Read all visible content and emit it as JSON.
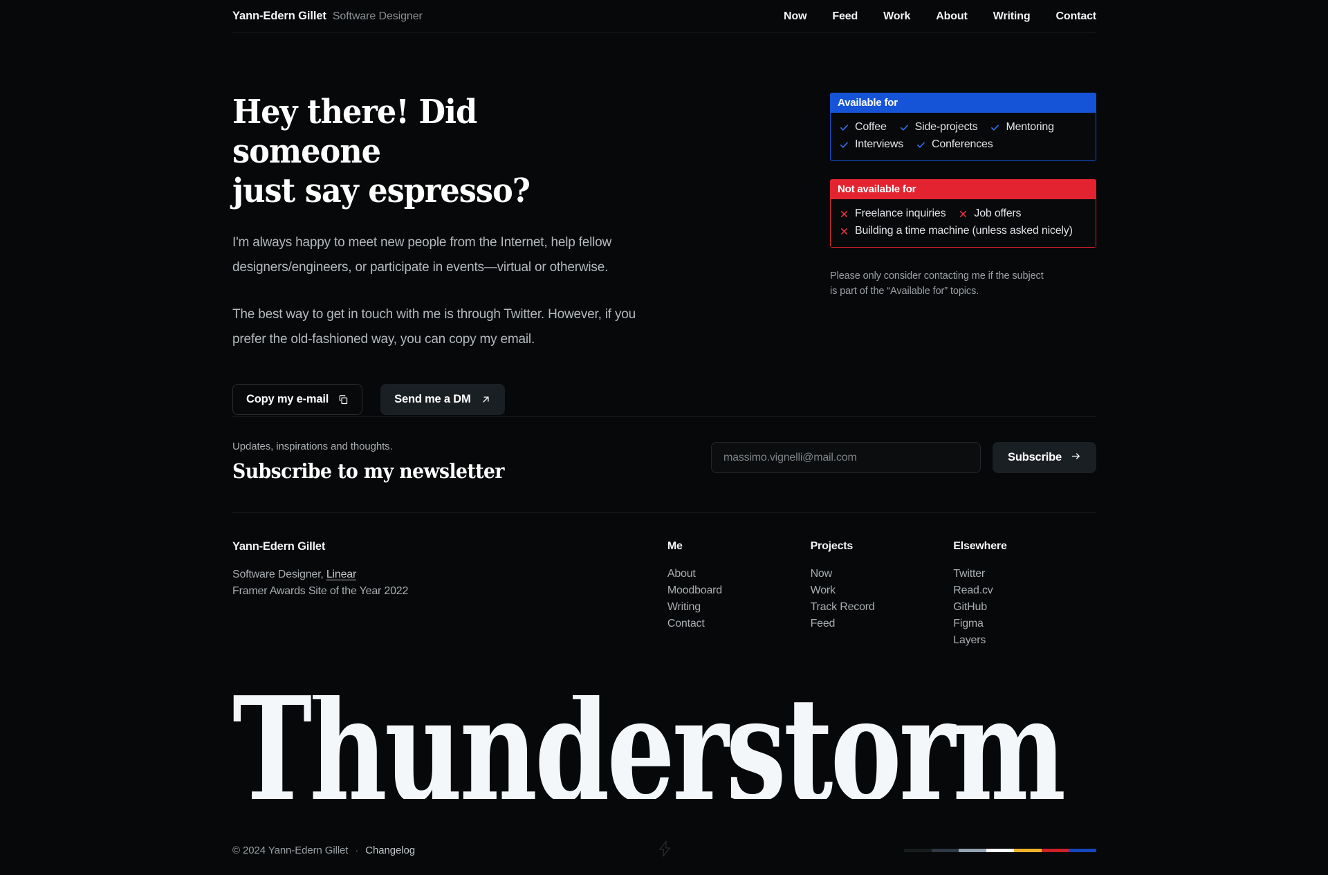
{
  "header": {
    "brand_name": "Yann-Edern Gillet",
    "brand_role": "Software Designer",
    "nav": [
      {
        "label": "Now"
      },
      {
        "label": "Feed"
      },
      {
        "label": "Work"
      },
      {
        "label": "About"
      },
      {
        "label": "Writing"
      },
      {
        "label": "Contact"
      }
    ]
  },
  "hero": {
    "title": "Hey there! Did someone\njust say espresso?",
    "paragraph_1": "I'm always happy to meet new people from the Internet, help fellow designers/engineers, or participate in events—virtual or otherwise.",
    "paragraph_2": "The best way to get in touch with me is through Twitter. However, if you prefer the old-fashioned way, you can copy my email.",
    "copy_email_label": "Copy my e-mail",
    "send_dm_label": "Send me a DM"
  },
  "availability": {
    "available": {
      "title": "Available for",
      "color": "#1554d6",
      "items": [
        "Coffee",
        "Side-projects",
        "Mentoring",
        "Interviews",
        "Conferences"
      ]
    },
    "not_available": {
      "title": "Not available for",
      "color": "#e32430",
      "items": [
        "Freelance inquiries",
        "Job offers",
        "Building a time machine (unless asked nicely)"
      ]
    },
    "note": "Please only consider contacting me if the subject is part of the “Available for” topics."
  },
  "newsletter": {
    "eyebrow": "Updates, inspirations and thoughts.",
    "title": "Subscribe to my newsletter",
    "email_value": "",
    "email_placeholder": "massimo.vignelli@mail.com",
    "submit_label": "Subscribe"
  },
  "footer": {
    "identity": {
      "name": "Yann-Edern Gillet",
      "role_prefix": "Software Designer,",
      "role_link": "Linear",
      "award": "Framer Awards Site of the Year 2022"
    },
    "columns": [
      {
        "title": "Me",
        "links": [
          "About",
          "Moodboard",
          "Writing",
          "Contact"
        ]
      },
      {
        "title": "Projects",
        "links": [
          "Now",
          "Work",
          "Track Record",
          "Feed"
        ]
      },
      {
        "title": "Elsewhere",
        "links": [
          "Twitter",
          "Read.cv",
          "GitHub",
          "Figma",
          "Layers"
        ]
      }
    ]
  },
  "wordmark": {
    "text": "Thunderstorm"
  },
  "bottom_bar": {
    "copyright": "© 2024 Yann-Edern Gillet",
    "separator": "·",
    "changelog": "Changelog",
    "swatches": [
      "#151c1b",
      "#2e3943",
      "#94a3b4",
      "#ffffff",
      "#efb12c",
      "#cf2027",
      "#1646bd"
    ]
  }
}
